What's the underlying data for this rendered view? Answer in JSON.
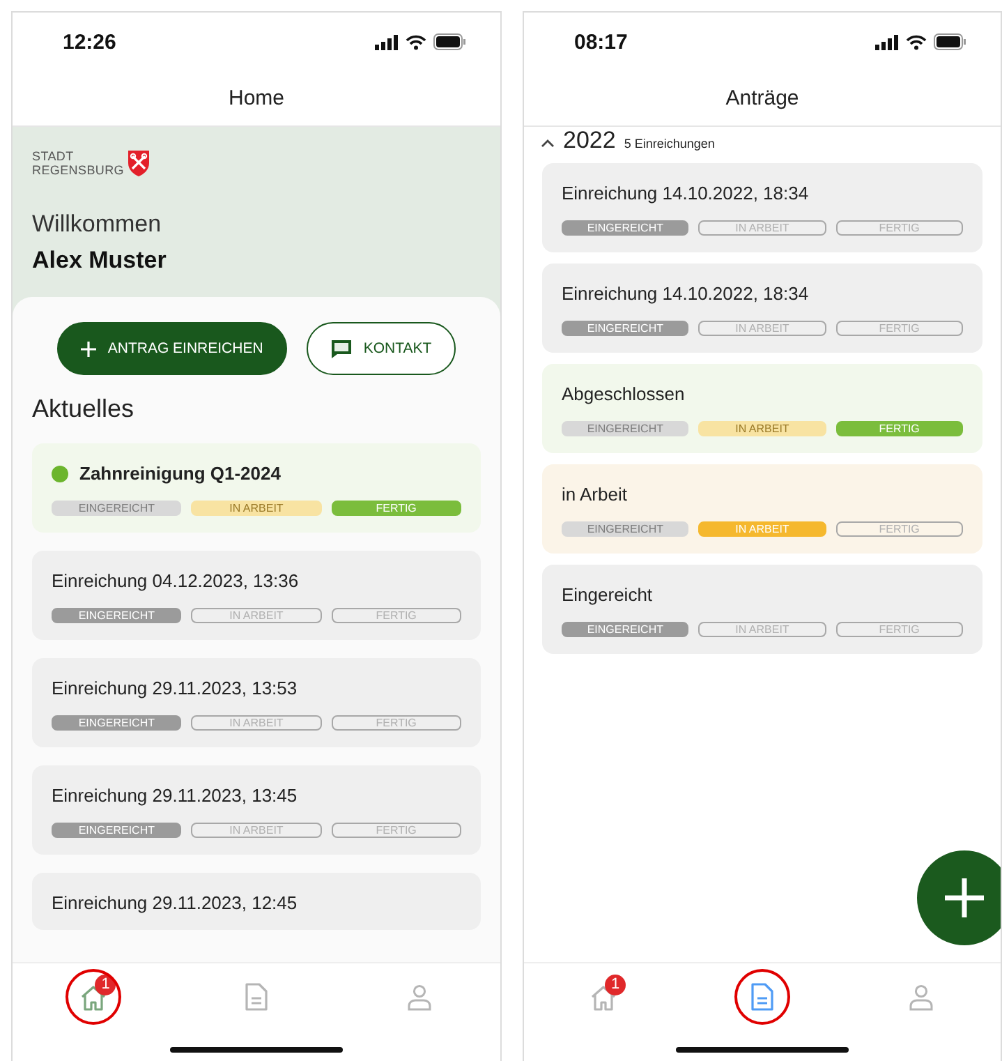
{
  "screens": [
    {
      "kind": "home",
      "status_bar": {
        "time": "12:26"
      },
      "title": "Home",
      "logo": {
        "lines": [
          "STADT",
          "REGENSBURG"
        ]
      },
      "greeting": "Willkommen",
      "user_name": "Alex Muster",
      "actions": [
        {
          "kind": "primary",
          "label": "ANTRAG EINREICHEN"
        },
        {
          "kind": "secondary",
          "label": "KONTAKT"
        }
      ],
      "section_title": "Aktuelles",
      "cards": [
        {
          "title": "Zahnreinigung Q1-2024",
          "kind": "done",
          "dot": true,
          "steps": [
            "EINGEREICHT",
            "IN ARBEIT",
            "FERTIG"
          ]
        },
        {
          "title": "Einreichung 04.12.2023, 13:36",
          "kind": "submitted",
          "dot": false,
          "steps": [
            "EINGEREICHT",
            "IN ARBEIT",
            "FERTIG"
          ]
        },
        {
          "title": "Einreichung 29.11.2023, 13:53",
          "kind": "submitted",
          "dot": false,
          "steps": [
            "EINGEREICHT",
            "IN ARBEIT",
            "FERTIG"
          ]
        },
        {
          "title": "Einreichung 29.11.2023, 13:45",
          "kind": "submitted",
          "dot": false,
          "steps": [
            "EINGEREICHT",
            "IN ARBEIT",
            "FERTIG"
          ]
        },
        {
          "title": "Einreichung 29.11.2023, 12:45",
          "kind": "submitted",
          "dot": false
        }
      ],
      "nav": [
        {
          "kind": "home",
          "selected": true,
          "highlighted": true,
          "badge": "1"
        },
        {
          "kind": "document",
          "selected": false,
          "highlighted": false
        },
        {
          "kind": "profile",
          "selected": false,
          "highlighted": false
        }
      ]
    },
    {
      "kind": "list",
      "status_bar": {
        "time": "08:17"
      },
      "title": "Anträge",
      "group": {
        "year": "2022",
        "count": "5 Einreichungen",
        "expanded": true
      },
      "cards": [
        {
          "title": "Einreichung 14.10.2022, 18:34",
          "kind": "submitted",
          "dot": false,
          "steps": [
            "EINGEREICHT",
            "IN ARBEIT",
            "FERTIG"
          ]
        },
        {
          "title": "Einreichung 14.10.2022, 18:34",
          "kind": "submitted",
          "dot": false,
          "steps": [
            "EINGEREICHT",
            "IN ARBEIT",
            "FERTIG"
          ]
        },
        {
          "title": "Abgeschlossen",
          "kind": "done",
          "dot": false,
          "steps": [
            "EINGEREICHT",
            "IN ARBEIT",
            "FERTIG"
          ]
        },
        {
          "title": "in Arbeit",
          "kind": "in_progress",
          "dot": false,
          "steps": [
            "EINGEREICHT",
            "IN ARBEIT",
            "FERTIG"
          ]
        },
        {
          "title": "Eingereicht",
          "kind": "submitted",
          "dot": false,
          "steps": [
            "EINGEREICHT",
            "IN ARBEIT",
            "FERTIG"
          ]
        }
      ],
      "fab": true,
      "nav": [
        {
          "kind": "home",
          "selected": false,
          "highlighted": false,
          "badge": "1"
        },
        {
          "kind": "document",
          "selected": true,
          "highlighted": true
        },
        {
          "kind": "profile",
          "selected": false,
          "highlighted": false
        }
      ]
    }
  ]
}
